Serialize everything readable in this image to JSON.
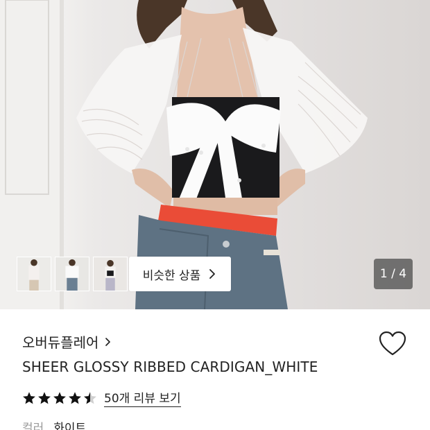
{
  "gallery": {
    "similar_button_label": "비슷한 상품",
    "counter": "1 / 4",
    "thumbnails": [
      "thumbnail-1",
      "thumbnail-2",
      "thumbnail-3"
    ]
  },
  "product": {
    "brand": "오버듀플레어",
    "title": "SHEER GLOSSY RIBBED CARDIGAN_WHITE",
    "rating": 4.5,
    "review_link": "50개 리뷰 보기",
    "color_label": "컬러",
    "color_value": "화이트"
  },
  "icons": {
    "chevron": "chevron-right-icon",
    "wishlist": "heart-outline-icon",
    "star": "star-icon"
  },
  "colors": {
    "text": "#222222",
    "muted": "#9a9a9a",
    "star": "#111111"
  }
}
